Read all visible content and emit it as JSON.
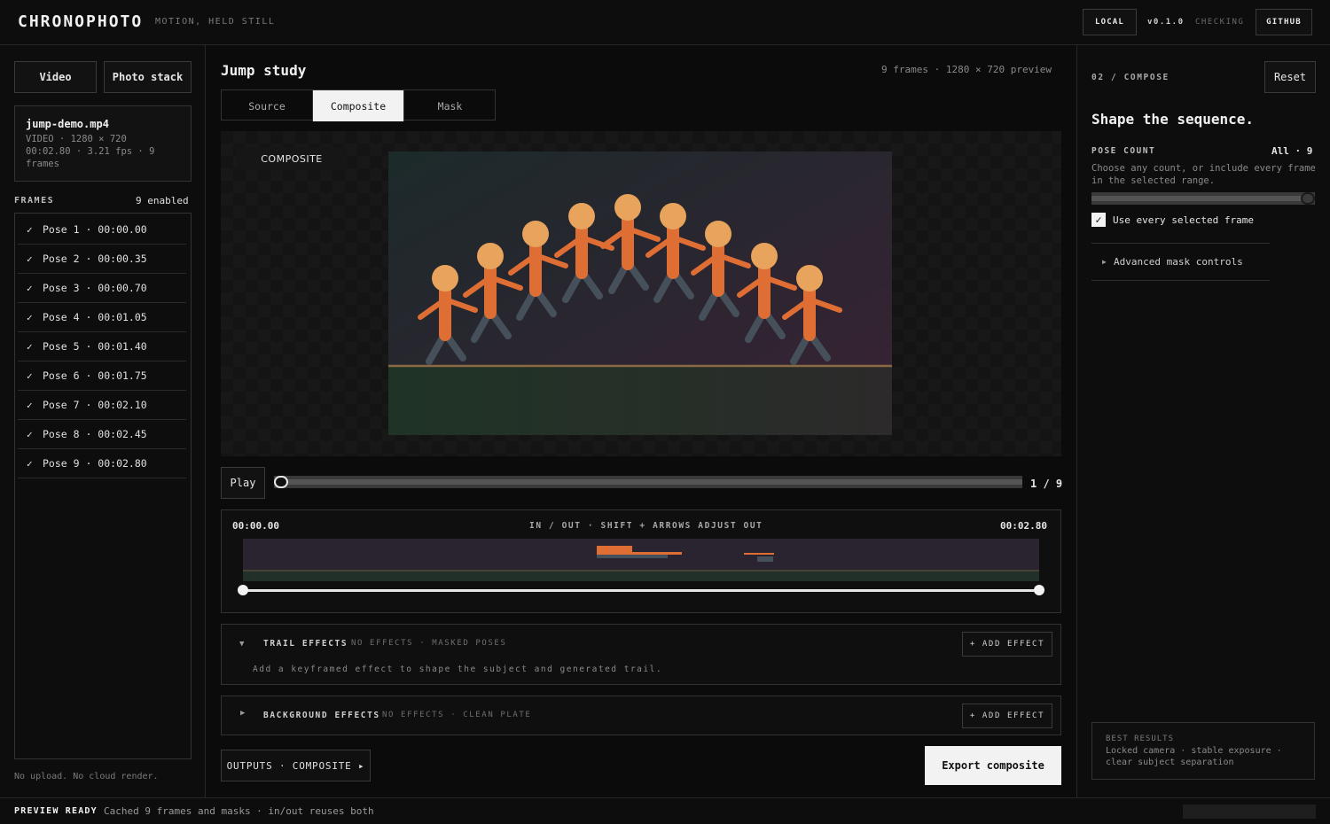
{
  "header": {
    "brand": "CHRONOPHOTO",
    "tagline": "MOTION, HELD STILL",
    "local_label": "LOCAL",
    "version": "v0.1.0",
    "update_status": "CHECKING",
    "github_label": "GITHUB"
  },
  "sidebar": {
    "mode_buttons": [
      "Video",
      "Photo stack"
    ],
    "file": {
      "name": "jump-demo.mp4",
      "meta_line1": "VIDEO · 1280 × 720",
      "meta_line2": "00:02.80 · 3.21 fps · 9",
      "meta_line3": "frames"
    },
    "frames_label": "FRAMES",
    "frames_enabled": "9 enabled",
    "frames": [
      {
        "check": "✓",
        "label": "Pose 1 · 00:00.00"
      },
      {
        "check": "✓",
        "label": "Pose 2 · 00:00.35"
      },
      {
        "check": "✓",
        "label": "Pose 3 · 00:00.70"
      },
      {
        "check": "✓",
        "label": "Pose 4 · 00:01.05"
      },
      {
        "check": "✓",
        "label": "Pose 5 · 00:01.40"
      },
      {
        "check": "✓",
        "label": "Pose 6 · 00:01.75"
      },
      {
        "check": "✓",
        "label": "Pose 7 · 00:02.10"
      },
      {
        "check": "✓",
        "label": "Pose 8 · 00:02.45"
      },
      {
        "check": "✓",
        "label": "Pose 9 · 00:02.80"
      }
    ],
    "privacy_note": "No upload. No cloud render."
  },
  "main": {
    "title": "Jump study",
    "meta": "9 frames · 1280 × 720 preview",
    "tabs": [
      {
        "label": "Source",
        "active": false
      },
      {
        "label": "Composite",
        "active": true
      },
      {
        "label": "Mask",
        "active": false
      }
    ],
    "preview_badge": "COMPOSITE",
    "play_label": "Play",
    "frame_position": 1,
    "frame_counter": "1 / 9",
    "range": {
      "in_time": "00:00.00",
      "hint": "IN / OUT · SHIFT + ARROWS ADJUST OUT",
      "out_time": "00:02.80",
      "in_fraction": 0,
      "out_fraction": 1
    },
    "trail_effects": {
      "title": "TRAIL EFFECTS",
      "status": "NO EFFECTS · MASKED POSES",
      "add_label": "+ ADD EFFECT",
      "description": "Add a keyframed effect to shape the subject and generated trail.",
      "expanded": true
    },
    "background_effects": {
      "title": "BACKGROUND EFFECTS",
      "status": "NO EFFECTS · CLEAN PLATE",
      "add_label": "+ ADD EFFECT",
      "expanded": false
    },
    "outputs_label": "OUTPUTS · COMPOSITE ▸",
    "export_label": "Export composite"
  },
  "compose": {
    "step": "02 / COMPOSE",
    "reset_label": "Reset",
    "heading": "Shape the sequence.",
    "pose_count_label": "POSE COUNT",
    "pose_count_value": "All · 9",
    "pose_count_help": "Choose any count, or include every frame in the selected range.",
    "pose_slider_fraction": 1,
    "use_every_frame_label": "Use every selected frame",
    "use_every_frame_checked": true,
    "advanced_label": "Advanced mask controls",
    "best_results_title": "BEST RESULTS",
    "best_results_line1": "Locked camera · stable exposure ·",
    "best_results_line2": "clear subject separation"
  },
  "footer": {
    "status": "PREVIEW READY",
    "detail": "Cached 9 frames and masks · in/out reuses both"
  },
  "colors": {
    "figure_head": "#e8a35c",
    "figure_body": "#df6e34",
    "figure_legs": "#46505a",
    "accent_white": "#f2f2f2"
  }
}
